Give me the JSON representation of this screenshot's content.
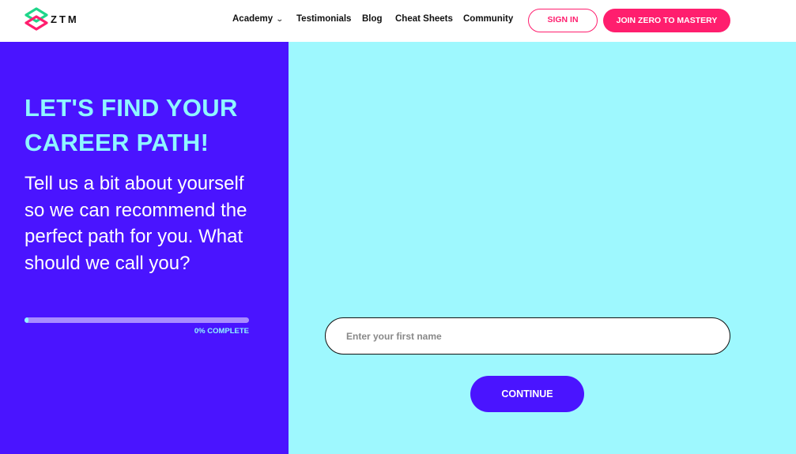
{
  "header": {
    "logo_text": "ZTM",
    "nav": [
      {
        "label": "Academy",
        "has_dropdown": true
      },
      {
        "label": "Testimonials"
      },
      {
        "label": "Blog"
      },
      {
        "label": "Cheat Sheets"
      },
      {
        "label": "Community"
      }
    ],
    "sign_in_label": "SIGN IN",
    "join_label": "JOIN ZERO TO MASTERY"
  },
  "intro": {
    "title": "LET'S FIND YOUR CAREER PATH!",
    "subtitle": "Tell us a bit about yourself so we can recommend the perfect path for you. What should we call you?"
  },
  "progress": {
    "value_percent": 0,
    "label": "0% COMPLETE"
  },
  "form": {
    "first_name_value": "",
    "first_name_placeholder": "Enter your first name",
    "continue_label": "CONTINUE"
  },
  "colors": {
    "brand_pink": "#ff1e6e",
    "left_panel": "#4a14ff",
    "right_panel": "#9ef8fe",
    "accent_cyan": "#8ff6ff"
  },
  "icons": {
    "logo": "ztm-logo-icon",
    "dropdown": "chevron-down-icon"
  }
}
